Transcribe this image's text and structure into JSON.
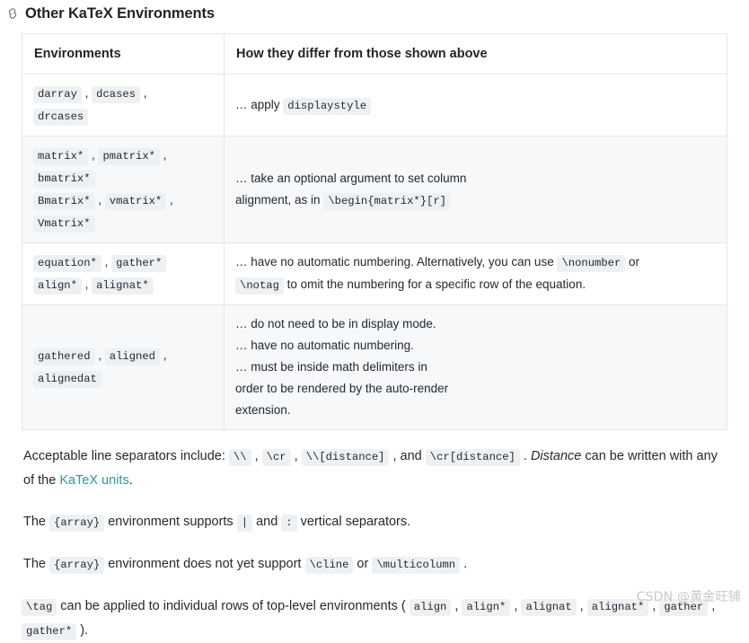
{
  "heading": {
    "icon": "link-anchor-icon",
    "text": "Other KaTeX Environments"
  },
  "table": {
    "columns": [
      {
        "label": "Environments"
      },
      {
        "label": "How they differ from those shown above"
      }
    ],
    "rows": [
      {
        "stripe": false,
        "environments": [
          {
            "line": [
              {
                "type": "code",
                "text": "darray"
              },
              {
                "type": "text",
                "text": " , "
              },
              {
                "type": "code",
                "text": "dcases"
              },
              {
                "type": "text",
                "text": " ,"
              }
            ]
          },
          {
            "line": [
              {
                "type": "code",
                "text": "drcases"
              }
            ]
          }
        ],
        "description": [
          {
            "line": [
              {
                "type": "text",
                "text": "… apply "
              },
              {
                "type": "code",
                "text": "displaystyle"
              }
            ]
          }
        ]
      },
      {
        "stripe": true,
        "environments": [
          {
            "line": [
              {
                "type": "code",
                "text": "matrix*"
              },
              {
                "type": "text",
                "text": " , "
              },
              {
                "type": "code",
                "text": "pmatrix*"
              },
              {
                "type": "text",
                "text": " ,"
              }
            ]
          },
          {
            "line": [
              {
                "type": "code",
                "text": "bmatrix*"
              }
            ]
          },
          {
            "line": [
              {
                "type": "code",
                "text": "Bmatrix*"
              },
              {
                "type": "text",
                "text": " , "
              },
              {
                "type": "code",
                "text": "vmatrix*"
              },
              {
                "type": "text",
                "text": " ,"
              }
            ]
          },
          {
            "line": [
              {
                "type": "code",
                "text": "Vmatrix*"
              }
            ]
          }
        ],
        "description": [
          {
            "line": [
              {
                "type": "text",
                "text": "… take an optional argument to set column"
              }
            ]
          },
          {
            "line": [
              {
                "type": "text",
                "text": "alignment, as in "
              },
              {
                "type": "code",
                "text": "\\begin{matrix*}[r]"
              }
            ]
          }
        ]
      },
      {
        "stripe": false,
        "environments": [
          {
            "line": [
              {
                "type": "code",
                "text": "equation*"
              },
              {
                "type": "text",
                "text": " , "
              },
              {
                "type": "code",
                "text": "gather*"
              }
            ]
          },
          {
            "line": [
              {
                "type": "code",
                "text": "align*"
              },
              {
                "type": "text",
                "text": " , "
              },
              {
                "type": "code",
                "text": "alignat*"
              }
            ]
          }
        ],
        "description": [
          {
            "line": [
              {
                "type": "text",
                "text": "… have no automatic numbering. Alternatively, you can use "
              },
              {
                "type": "code",
                "text": "\\nonumber"
              },
              {
                "type": "text",
                "text": " or"
              }
            ]
          },
          {
            "line": [
              {
                "type": "code",
                "text": "\\notag"
              },
              {
                "type": "text",
                "text": " to omit the numbering for a specific row of the equation."
              }
            ]
          }
        ]
      },
      {
        "stripe": true,
        "environments": [
          {
            "line": [
              {
                "type": "code",
                "text": "gathered"
              },
              {
                "type": "text",
                "text": " , "
              },
              {
                "type": "code",
                "text": "aligned"
              },
              {
                "type": "text",
                "text": " ,"
              }
            ]
          },
          {
            "line": [
              {
                "type": "code",
                "text": "alignedat"
              }
            ]
          }
        ],
        "description": [
          {
            "line": [
              {
                "type": "text",
                "text": "… do not need to be in display mode."
              }
            ]
          },
          {
            "line": [
              {
                "type": "text",
                "text": "… have no automatic numbering."
              }
            ]
          },
          {
            "line": [
              {
                "type": "text",
                "text": "… must be inside math delimiters in"
              }
            ]
          },
          {
            "line": [
              {
                "type": "text",
                "text": "order to be rendered by the auto-render"
              }
            ]
          },
          {
            "line": [
              {
                "type": "text",
                "text": "extension."
              }
            ]
          }
        ]
      }
    ]
  },
  "paragraphs": [
    {
      "name": "paragraph-line-separators",
      "parts": [
        {
          "type": "text",
          "text": "Acceptable line separators include: "
        },
        {
          "type": "code",
          "text": "\\\\"
        },
        {
          "type": "text",
          "text": " , "
        },
        {
          "type": "code",
          "text": "\\cr"
        },
        {
          "type": "text",
          "text": " , "
        },
        {
          "type": "code",
          "text": "\\\\[distance]"
        },
        {
          "type": "text",
          "text": " , and "
        },
        {
          "type": "code",
          "text": "\\cr[distance]"
        },
        {
          "type": "text",
          "text": " . "
        },
        {
          "type": "italic",
          "text": "Distance"
        },
        {
          "type": "text",
          "text": " can be written with any of the "
        },
        {
          "type": "link",
          "text": "KaTeX units"
        },
        {
          "type": "text",
          "text": "."
        }
      ]
    },
    {
      "name": "paragraph-array-supports",
      "parts": [
        {
          "type": "text",
          "text": "The "
        },
        {
          "type": "code",
          "text": "{array}"
        },
        {
          "type": "text",
          "text": " environment supports "
        },
        {
          "type": "code",
          "text": "|"
        },
        {
          "type": "text",
          "text": " and "
        },
        {
          "type": "code",
          "text": ":"
        },
        {
          "type": "text",
          "text": " vertical separators."
        }
      ]
    },
    {
      "name": "paragraph-array-unsupported",
      "parts": [
        {
          "type": "text",
          "text": "The "
        },
        {
          "type": "code",
          "text": "{array}"
        },
        {
          "type": "text",
          "text": " environment does not yet support "
        },
        {
          "type": "code",
          "text": "\\cline"
        },
        {
          "type": "text",
          "text": " or "
        },
        {
          "type": "code",
          "text": "\\multicolumn"
        },
        {
          "type": "text",
          "text": " ."
        }
      ]
    },
    {
      "name": "paragraph-tag",
      "parts": [
        {
          "type": "code",
          "text": "\\tag"
        },
        {
          "type": "text",
          "text": " can be applied to individual rows of top-level environments ( "
        },
        {
          "type": "code",
          "text": "align"
        },
        {
          "type": "text",
          "text": " , "
        },
        {
          "type": "code",
          "text": "align*"
        },
        {
          "type": "text",
          "text": " , "
        },
        {
          "type": "code",
          "text": "alignat"
        },
        {
          "type": "text",
          "text": " , "
        },
        {
          "type": "code",
          "text": "alignat*"
        },
        {
          "type": "text",
          "text": " , "
        },
        {
          "type": "code",
          "text": "gather"
        },
        {
          "type": "text",
          "text": " , "
        },
        {
          "type": "code",
          "text": "gather*"
        },
        {
          "type": "text",
          "text": " )."
        }
      ]
    }
  ],
  "watermark": {
    "text": "CSDN @黄金旺铺"
  },
  "colors": {
    "link": "#2e9a9a",
    "code_background": "#eef1f3",
    "stripe_background": "#f6f8fa",
    "border": "#e3e6e8",
    "text": "#24292e",
    "watermark": "#c9c9c9"
  }
}
